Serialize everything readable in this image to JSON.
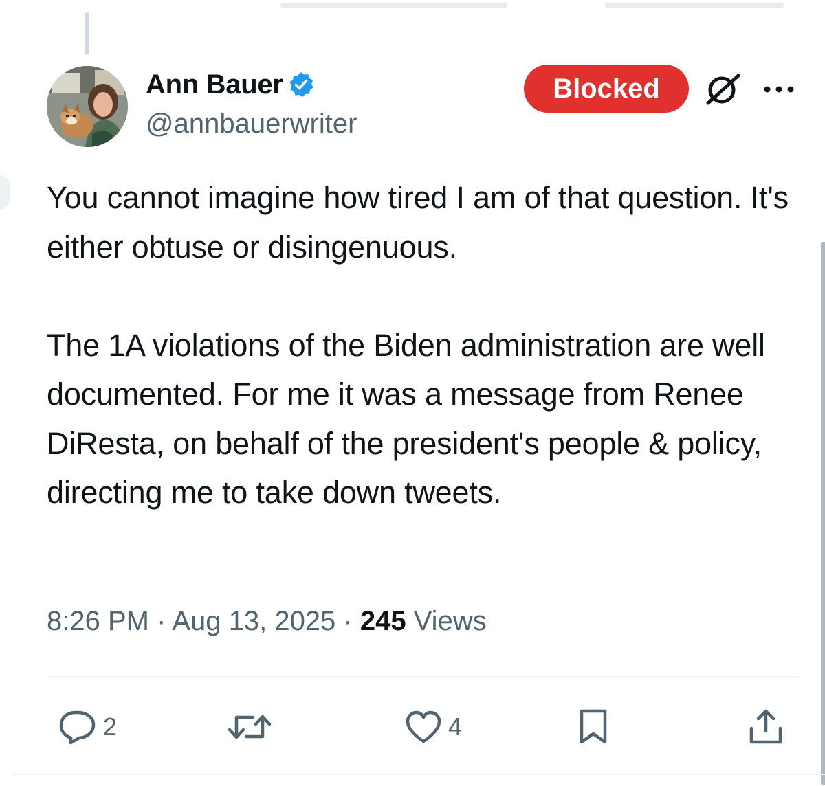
{
  "author": {
    "display_name": "Ann Bauer",
    "handle": "@annbauerwriter",
    "verified": true,
    "badge_color": "#1d9bf0"
  },
  "header": {
    "blocked_label": "Blocked",
    "blocked_color": "#e0312f",
    "icons": [
      "grok-icon",
      "more-options-icon"
    ]
  },
  "tweet": {
    "paragraph_1": "You cannot imagine how tired I am of that question. It's either obtuse or disingenuous.",
    "paragraph_2": "The 1A violations of the Biden administration are well documented. For me it was a message from Renee DiResta, on behalf of the president's people & policy, directing me to take down tweets."
  },
  "meta": {
    "time": "8:26 PM",
    "separator": " · ",
    "date": "Aug 13, 2025",
    "views_count": "245",
    "views_label": " Views"
  },
  "actions": {
    "reply_count": "2",
    "retweet_count": "",
    "like_count": "4",
    "icons": [
      "reply-icon",
      "retweet-icon",
      "like-icon",
      "bookmark-icon",
      "share-icon"
    ]
  },
  "colors": {
    "text_primary": "#0f1419",
    "text_secondary": "#536471",
    "divider": "#eff3f4"
  }
}
